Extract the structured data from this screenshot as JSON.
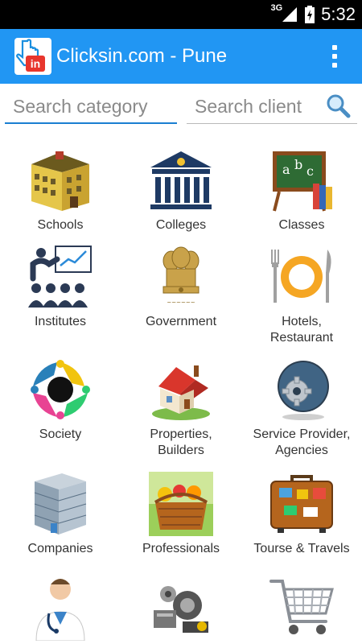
{
  "status_bar": {
    "network": "3G",
    "time": "5:32"
  },
  "app_bar": {
    "logo_text": "in",
    "title": "Clicksin.com - Pune"
  },
  "search": {
    "category_placeholder": "Search category",
    "client_placeholder": "Search client"
  },
  "categories": [
    {
      "label": "Schools",
      "icon": "school-building-icon"
    },
    {
      "label": "Colleges",
      "icon": "college-pillars-icon"
    },
    {
      "label": "Classes",
      "icon": "abc-chalkboard-icon"
    },
    {
      "label": "Institutes",
      "icon": "presentation-audience-icon"
    },
    {
      "label": "Government",
      "icon": "national-emblem-icon"
    },
    {
      "label": "Hotels,\nRestaurant",
      "icon": "plate-fork-knife-icon"
    },
    {
      "label": "Society",
      "icon": "people-circle-icon"
    },
    {
      "label": "Properties,\nBuilders",
      "icon": "house-icon"
    },
    {
      "label": "Service Provider,\nAgencies",
      "icon": "gear-globe-icon"
    },
    {
      "label": "Companies",
      "icon": "office-building-icon"
    },
    {
      "label": "Professionals",
      "icon": "fruit-basket-icon"
    },
    {
      "label": "Tourse & Travels",
      "icon": "suitcase-icon"
    },
    {
      "label": "",
      "icon": "doctor-icon"
    },
    {
      "label": "",
      "icon": "auto-parts-icon"
    },
    {
      "label": "",
      "icon": "shopping-cart-icon"
    }
  ]
}
